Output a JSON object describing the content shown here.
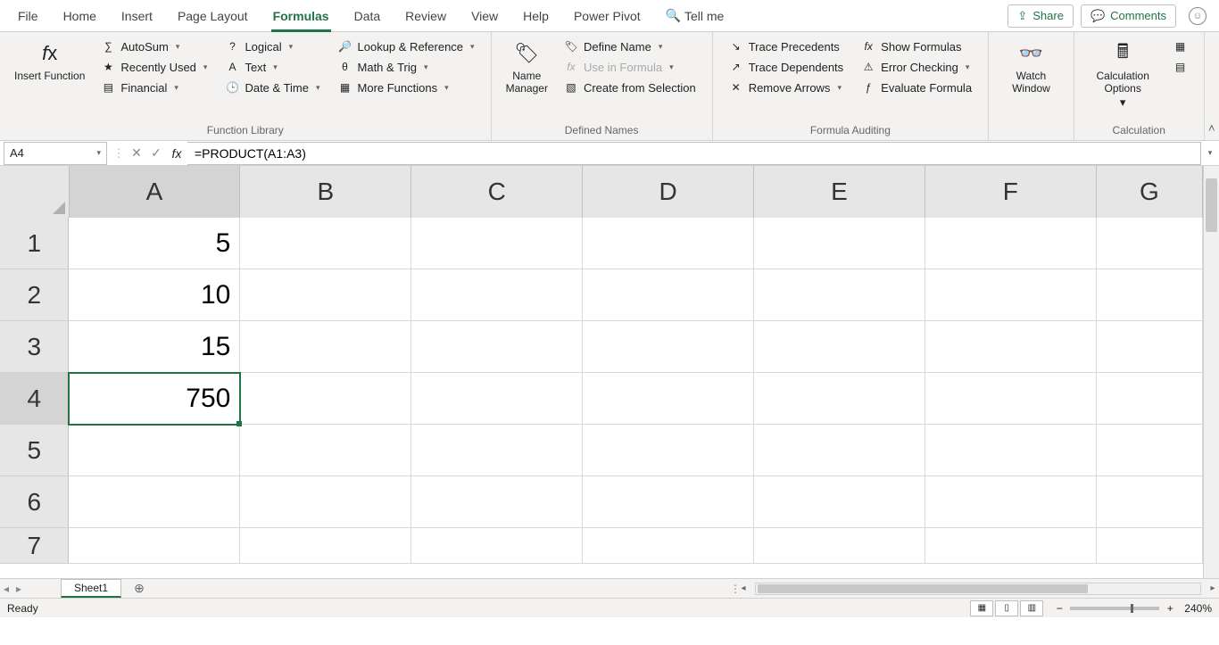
{
  "tabs": [
    "File",
    "Home",
    "Insert",
    "Page Layout",
    "Formulas",
    "Data",
    "Review",
    "View",
    "Help",
    "Power Pivot"
  ],
  "active_tab": "Formulas",
  "tell_me": "Tell me",
  "share": "Share",
  "comments": "Comments",
  "ribbon": {
    "insert_function": "Insert Function",
    "function_library": {
      "label": "Function Library",
      "autosum": "AutoSum",
      "recently_used": "Recently Used",
      "financial": "Financial",
      "logical": "Logical",
      "text": "Text",
      "date_time": "Date & Time",
      "lookup": "Lookup & Reference",
      "math_trig": "Math & Trig",
      "more_functions": "More Functions"
    },
    "defined_names": {
      "label": "Defined Names",
      "name_manager": "Name Manager",
      "define_name": "Define Name",
      "use_in_formula": "Use in Formula",
      "create_from_selection": "Create from Selection"
    },
    "formula_auditing": {
      "label": "Formula Auditing",
      "trace_precedents": "Trace Precedents",
      "trace_dependents": "Trace Dependents",
      "remove_arrows": "Remove Arrows",
      "show_formulas": "Show Formulas",
      "error_checking": "Error Checking",
      "evaluate_formula": "Evaluate Formula"
    },
    "watch_window": "Watch Window",
    "calculation": {
      "label": "Calculation",
      "options": "Calculation Options"
    }
  },
  "namebox": "A4",
  "formula": "=PRODUCT(A1:A3)",
  "columns": [
    "A",
    "B",
    "C",
    "D",
    "E",
    "F",
    "G"
  ],
  "rows": [
    "1",
    "2",
    "3",
    "4",
    "5",
    "6",
    "7"
  ],
  "cells": {
    "A1": "5",
    "A2": "10",
    "A3": "15",
    "A4": "750"
  },
  "selected_cell": "A4",
  "sheet": "Sheet1",
  "status": "Ready",
  "zoom": "240%"
}
